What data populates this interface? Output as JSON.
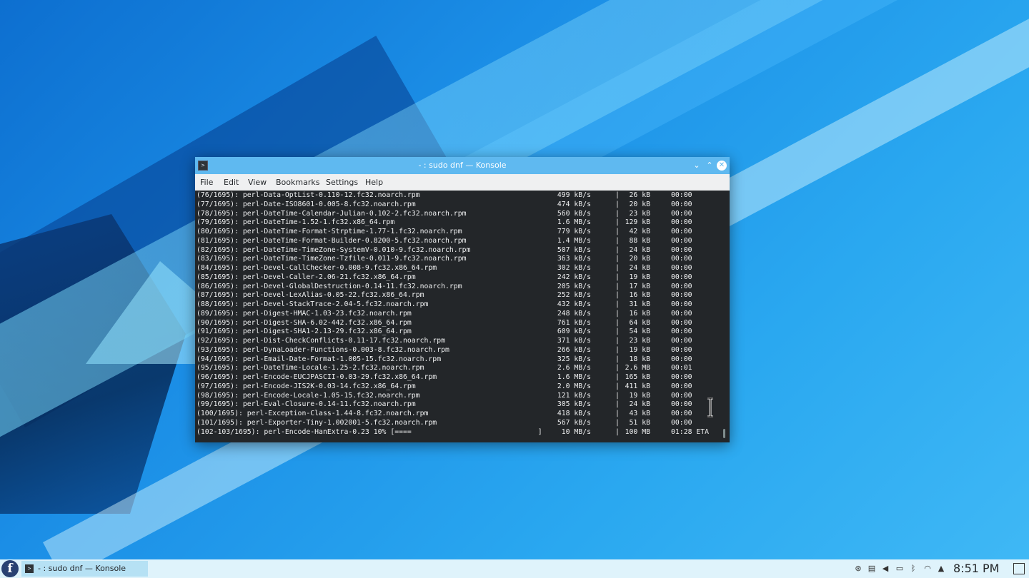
{
  "window": {
    "title": "- : sudo dnf — Konsole",
    "controls": {
      "minimize": "⌄",
      "maximize": "⌃",
      "close": "✕"
    }
  },
  "menu": [
    "File",
    "Edit",
    "View",
    "Bookmarks",
    "Settings",
    "Help"
  ],
  "terminal": {
    "rows": [
      {
        "name": "(76/1695): perl-Data-OptList-0.110-12.fc32.noarch.rpm",
        "speed": "499 kB/s",
        "size": "26 kB",
        "time": "00:00"
      },
      {
        "name": "(77/1695): perl-Date-ISO8601-0.005-8.fc32.noarch.rpm",
        "speed": "474 kB/s",
        "size": "20 kB",
        "time": "00:00"
      },
      {
        "name": "(78/1695): perl-DateTime-Calendar-Julian-0.102-2.fc32.noarch.rpm",
        "speed": "560 kB/s",
        "size": "23 kB",
        "time": "00:00"
      },
      {
        "name": "(79/1695): perl-DateTime-1.52-1.fc32.x86_64.rpm",
        "speed": "1.6 MB/s",
        "size": "129 kB",
        "time": "00:00"
      },
      {
        "name": "(80/1695): perl-DateTime-Format-Strptime-1.77-1.fc32.noarch.rpm",
        "speed": "779 kB/s",
        "size": "42 kB",
        "time": "00:00"
      },
      {
        "name": "(81/1695): perl-DateTime-Format-Builder-0.8200-5.fc32.noarch.rpm",
        "speed": "1.4 MB/s",
        "size": "88 kB",
        "time": "00:00"
      },
      {
        "name": "(82/1695): perl-DateTime-TimeZone-SystemV-0.010-9.fc32.noarch.rpm",
        "speed": "507 kB/s",
        "size": "24 kB",
        "time": "00:00"
      },
      {
        "name": "(83/1695): perl-DateTime-TimeZone-Tzfile-0.011-9.fc32.noarch.rpm",
        "speed": "363 kB/s",
        "size": "20 kB",
        "time": "00:00"
      },
      {
        "name": "(84/1695): perl-Devel-CallChecker-0.008-9.fc32.x86_64.rpm",
        "speed": "302 kB/s",
        "size": "24 kB",
        "time": "00:00"
      },
      {
        "name": "(85/1695): perl-Devel-Caller-2.06-21.fc32.x86_64.rpm",
        "speed": "242 kB/s",
        "size": "19 kB",
        "time": "00:00"
      },
      {
        "name": "(86/1695): perl-Devel-GlobalDestruction-0.14-11.fc32.noarch.rpm",
        "speed": "205 kB/s",
        "size": "17 kB",
        "time": "00:00"
      },
      {
        "name": "(87/1695): perl-Devel-LexAlias-0.05-22.fc32.x86_64.rpm",
        "speed": "252 kB/s",
        "size": "16 kB",
        "time": "00:00"
      },
      {
        "name": "(88/1695): perl-Devel-StackTrace-2.04-5.fc32.noarch.rpm",
        "speed": "432 kB/s",
        "size": "31 kB",
        "time": "00:00"
      },
      {
        "name": "(89/1695): perl-Digest-HMAC-1.03-23.fc32.noarch.rpm",
        "speed": "248 kB/s",
        "size": "16 kB",
        "time": "00:00"
      },
      {
        "name": "(90/1695): perl-Digest-SHA-6.02-442.fc32.x86_64.rpm",
        "speed": "761 kB/s",
        "size": "64 kB",
        "time": "00:00"
      },
      {
        "name": "(91/1695): perl-Digest-SHA1-2.13-29.fc32.x86_64.rpm",
        "speed": "609 kB/s",
        "size": "54 kB",
        "time": "00:00"
      },
      {
        "name": "(92/1695): perl-Dist-CheckConflicts-0.11-17.fc32.noarch.rpm",
        "speed": "371 kB/s",
        "size": "23 kB",
        "time": "00:00"
      },
      {
        "name": "(93/1695): perl-DynaLoader-Functions-0.003-8.fc32.noarch.rpm",
        "speed": "266 kB/s",
        "size": "19 kB",
        "time": "00:00"
      },
      {
        "name": "(94/1695): perl-Email-Date-Format-1.005-15.fc32.noarch.rpm",
        "speed": "325 kB/s",
        "size": "18 kB",
        "time": "00:00"
      },
      {
        "name": "(95/1695): perl-DateTime-Locale-1.25-2.fc32.noarch.rpm",
        "speed": "2.6 MB/s",
        "size": "2.6 MB",
        "time": "00:01"
      },
      {
        "name": "(96/1695): perl-Encode-EUCJPASCII-0.03-29.fc32.x86_64.rpm",
        "speed": "1.6 MB/s",
        "size": "165 kB",
        "time": "00:00"
      },
      {
        "name": "(97/1695): perl-Encode-JIS2K-0.03-14.fc32.x86_64.rpm",
        "speed": "2.0 MB/s",
        "size": "411 kB",
        "time": "00:00"
      },
      {
        "name": "(98/1695): perl-Encode-Locale-1.05-15.fc32.noarch.rpm",
        "speed": "121 kB/s",
        "size": "19 kB",
        "time": "00:00"
      },
      {
        "name": "(99/1695): perl-Eval-Closure-0.14-11.fc32.noarch.rpm",
        "speed": "305 kB/s",
        "size": "24 kB",
        "time": "00:00"
      },
      {
        "name": "(100/1695): perl-Exception-Class-1.44-8.fc32.noarch.rpm",
        "speed": "418 kB/s",
        "size": "43 kB",
        "time": "00:00"
      },
      {
        "name": "(101/1695): perl-Exporter-Tiny-1.002001-5.fc32.noarch.rpm",
        "speed": "567 kB/s",
        "size": "51 kB",
        "time": "00:00"
      },
      {
        "name": "(102-103/1695): perl-Encode-HanExtra-0.23 10% [====                              ]",
        "speed": "10 MB/s",
        "size": "100 MB",
        "time": "01:28 ETA"
      }
    ]
  },
  "taskbar": {
    "launcher_glyph": "f",
    "task_label": "- : sudo dnf — Konsole",
    "terminal_glyph": ">",
    "clock": "8:51 PM",
    "tray_icons": [
      "updates-icon",
      "clipboard-icon",
      "volume-icon",
      "battery-icon",
      "bluetooth-icon",
      "wifi-icon",
      "expand-tray-icon"
    ]
  }
}
